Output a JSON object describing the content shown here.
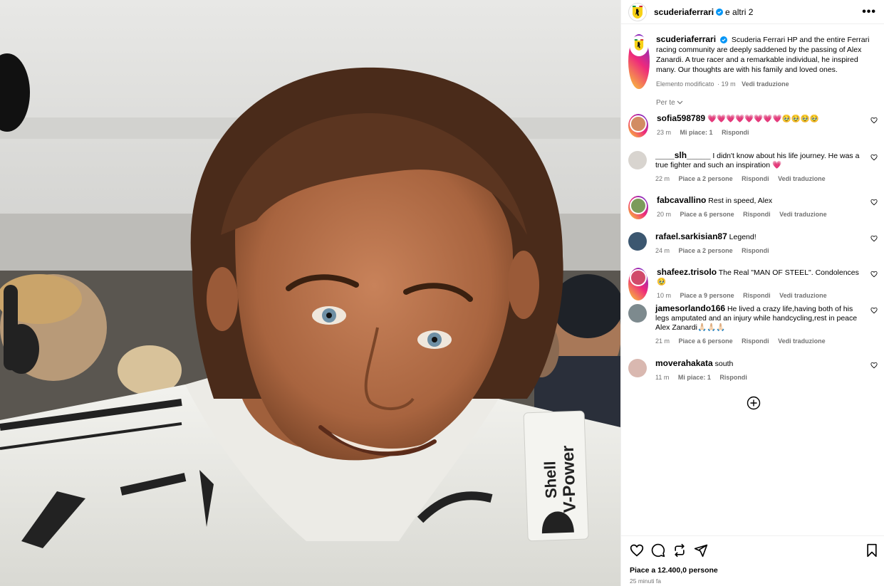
{
  "post_header": {
    "username": "scuderiaferrari",
    "collaborators": "e altri 2",
    "more_label": "•••"
  },
  "caption": {
    "username": "scuderiaferrari",
    "text": "Scuderia Ferrari HP and the entire Ferrari racing community are deeply saddened by the passing of Alex Zanardi. A true racer and a remarkable individual, he inspired many. Our thoughts are with his family and loved ones.",
    "edited": "Elemento modificato",
    "time": "· 19 m",
    "translate": "Vedi traduzione"
  },
  "filter_label": "Per te",
  "comments": [
    {
      "username": "sofia598789",
      "text": "💗💗💗💗💗💗💗💗🥹🥹🥹🥹",
      "time": "23 m",
      "likes": "Mi piace: 1",
      "reply": "Rispondi",
      "translate": ""
    },
    {
      "username": "____slh_____",
      "text": "I didn't know about his life journey. He was a true fighter and such an inspiration 💗",
      "time": "22 m",
      "likes": "Piace a 2 persone",
      "reply": "Rispondi",
      "translate": "Vedi traduzione"
    },
    {
      "username": "fabcavallino",
      "text": "Rest in speed, Alex",
      "time": "20 m",
      "likes": "Piace a 6 persone",
      "reply": "Rispondi",
      "translate": "Vedi traduzione"
    },
    {
      "username": "rafael.sarkisian87",
      "text": "Legend!",
      "time": "24 m",
      "likes": "Piace a 2 persone",
      "reply": "Rispondi",
      "translate": ""
    },
    {
      "username": "shafeez.trisolo",
      "text": "The Real \"MAN OF STEEL\". Condolences 🥹",
      "time": "10 m",
      "likes": "Piace a 9 persone",
      "reply": "Rispondi",
      "translate": "Vedi traduzione"
    },
    {
      "username": "jamesorlando166",
      "text": "He lived a crazy life,having both of his legs amputated and an injury while handcycling,rest in peace Alex Zanardi🙏🏻🙏🏻🙏🏻",
      "time": "21 m",
      "likes": "Piace a 6 persone",
      "reply": "Rispondi",
      "translate": "Vedi traduzione"
    },
    {
      "username": "moverahakata",
      "text": "south",
      "time": "11 m",
      "likes": "Mi piace: 1",
      "reply": "Rispondi",
      "translate": ""
    }
  ],
  "footer": {
    "likes": "Piace a 12.400,0 persone",
    "time_ago": "25 minuti fa"
  },
  "photo": {
    "suit_brand_1": "Shell",
    "suit_brand_2": "V-Power"
  },
  "colors": {
    "verified": "#0095f6",
    "muted": "#737373",
    "heart_emoji": "#ff3b6b"
  }
}
